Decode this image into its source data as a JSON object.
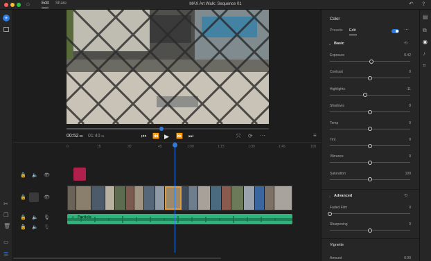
{
  "window": {
    "title": "MAX Art Walk: Sequence 01",
    "tabs": [
      "Edit",
      "Share"
    ],
    "active_tab": "Edit"
  },
  "transport": {
    "current_time": "00:52",
    "current_frames": "29",
    "duration_time": "01:40",
    "duration_frames": "41"
  },
  "ruler": {
    "ticks": [
      "0",
      "15",
      "30",
      "45",
      "1:00",
      "1:15",
      "1:30",
      "1:45",
      "100"
    ]
  },
  "tracks": {
    "audio_clip_label": "Particle"
  },
  "panel": {
    "title": "Color",
    "tabs": [
      "Presets",
      "Edit"
    ],
    "active_tab": "Edit",
    "toggle_on": true,
    "sections": {
      "basic": "Basic",
      "advanced": "Advanced",
      "vignette": "Vignette"
    },
    "basic_sliders": [
      {
        "label": "Exposure",
        "value": "0.42",
        "level": 0.52
      },
      {
        "label": "Contrast",
        "value": "0",
        "level": 0.5
      },
      {
        "label": "Highlights",
        "value": "-11",
        "level": 0.44
      },
      {
        "label": "Shadows",
        "value": "0",
        "level": 0.5
      },
      {
        "label": "Temp",
        "value": "0",
        "level": 0.5
      },
      {
        "label": "Tint",
        "value": "0",
        "level": 0.5
      },
      {
        "label": "Vibrance",
        "value": "0",
        "level": 0.5
      },
      {
        "label": "Saturation",
        "value": "100",
        "level": 0.5
      }
    ],
    "advanced_sliders": [
      {
        "label": "Faded Film",
        "value": "0",
        "level": 0.0
      },
      {
        "label": "Sharpening",
        "value": "0",
        "level": 0.5
      }
    ],
    "vignette_sliders": [
      {
        "label": "Amount",
        "value": "0.00"
      }
    ]
  },
  "colors": {
    "accent": "#2d7be0",
    "playhead": "#2d7be0",
    "clip_highlight": "#e09a3a",
    "audio_green": "#2fb37a",
    "title_clip": "#b0204c"
  },
  "icons": {
    "home": "home-icon",
    "undo": "undo-icon",
    "share": "share-icon",
    "add": "plus-icon",
    "media": "media-icon"
  }
}
